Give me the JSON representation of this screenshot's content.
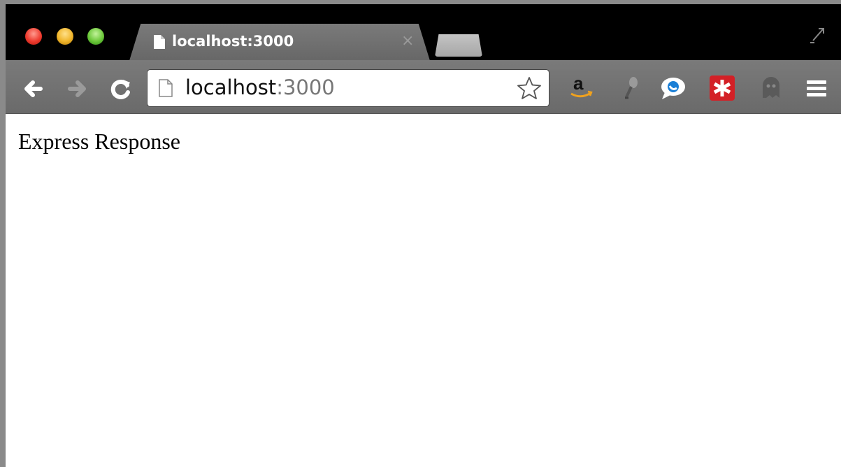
{
  "window": {
    "tab_title": "localhost:3000",
    "tab_close_glyph": "×"
  },
  "toolbar": {
    "url_host": "localhost",
    "url_port": ":3000",
    "extensions": [
      "amazon-icon",
      "microphone-icon",
      "chat-bubble-icon",
      "lastpass-icon",
      "ghostery-icon"
    ]
  },
  "page": {
    "text": "Express Response"
  },
  "colors": {
    "titlebar": "#000000",
    "toolbar": "#707070",
    "lastpass": "#d32026",
    "amazon_arrow": "#f0a21e"
  }
}
